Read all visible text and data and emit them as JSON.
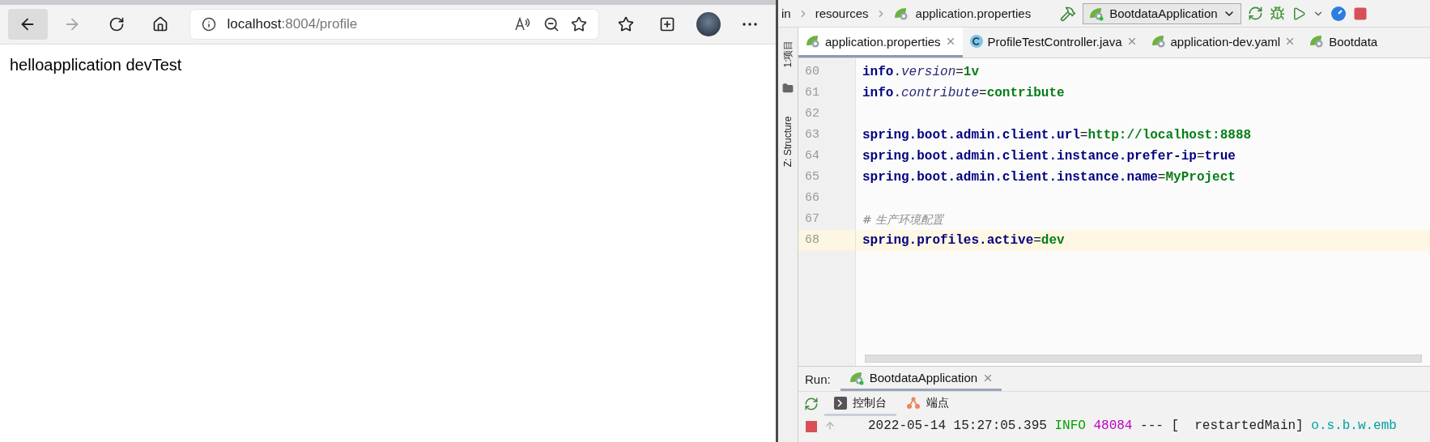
{
  "browser": {
    "nav_buttons": [
      {
        "kind": "back",
        "disabled": false,
        "hovered": true
      },
      {
        "kind": "forward",
        "disabled": true,
        "hovered": false
      },
      {
        "kind": "refresh",
        "disabled": false,
        "hovered": false
      },
      {
        "kind": "home",
        "disabled": false,
        "hovered": false
      }
    ],
    "address": {
      "host": "localhost",
      "path": ":8004/profile"
    },
    "page_text": "helloapplication devTest"
  },
  "ide": {
    "breadcrumbs": [
      "in",
      "resources",
      "application.properties"
    ],
    "run_config": "BootdataApplication",
    "tool_labels": [
      "1:项目",
      "Z: Structure"
    ],
    "tabs": [
      {
        "label": "application.properties",
        "kind": "spring",
        "selected": true,
        "closable": true
      },
      {
        "label": "ProfileTestController.java",
        "kind": "class",
        "selected": false,
        "closable": true
      },
      {
        "label": "application-dev.yaml",
        "kind": "spring",
        "selected": false,
        "closable": true
      },
      {
        "label": "Bootdata",
        "kind": "boot",
        "selected": false,
        "closable": false
      }
    ],
    "lines": [
      {
        "number": "60",
        "current": false,
        "tokens": [
          {
            "text": "info",
            "kind": "key"
          },
          {
            "text": ".",
            "kind": "op"
          },
          {
            "text": "version",
            "kind": "field"
          },
          {
            "text": "=",
            "kind": "op"
          },
          {
            "text": "1v",
            "kind": "value"
          }
        ]
      },
      {
        "number": "61",
        "current": false,
        "tokens": [
          {
            "text": "info",
            "kind": "key"
          },
          {
            "text": ".",
            "kind": "op"
          },
          {
            "text": "contribute",
            "kind": "field"
          },
          {
            "text": "=",
            "kind": "op"
          },
          {
            "text": "contribute",
            "kind": "value"
          }
        ]
      },
      {
        "number": "62",
        "current": false
      },
      {
        "number": "63",
        "current": false,
        "tokens": [
          {
            "text": "spring.boot.admin.client.url",
            "kind": "key"
          },
          {
            "text": "=",
            "kind": "op"
          },
          {
            "text": "http://localhost:8888",
            "kind": "value"
          }
        ]
      },
      {
        "number": "64",
        "current": false,
        "tokens": [
          {
            "text": "spring.boot.admin.client.instance.prefer-ip",
            "kind": "key"
          },
          {
            "text": "=",
            "kind": "op"
          },
          {
            "text": "true",
            "kind": "key"
          }
        ]
      },
      {
        "number": "65",
        "current": false,
        "tokens": [
          {
            "text": "spring.boot.admin.client.instance.name",
            "kind": "key"
          },
          {
            "text": "=",
            "kind": "op"
          },
          {
            "text": "MyProject",
            "kind": "value"
          }
        ]
      },
      {
        "number": "66",
        "current": false
      },
      {
        "number": "67",
        "current": false,
        "tokens": [
          {
            "text": "# 生产环境配置",
            "kind": "comment"
          }
        ]
      },
      {
        "number": "68",
        "current": true,
        "tokens": [
          {
            "text": "spring.profiles.active",
            "kind": "key"
          },
          {
            "text": "=",
            "kind": "op"
          },
          {
            "text": "dev",
            "kind": "value"
          }
        ]
      }
    ],
    "run_panel": {
      "label": "Run:",
      "tabs": [
        {
          "label": "BootdataApplication",
          "selected": true
        }
      ],
      "subtabs": [
        {
          "label": "控制台",
          "kind": "console",
          "selected": true
        },
        {
          "label": "端点",
          "kind": "endpoints",
          "selected": false
        }
      ],
      "log": [
        {
          "text": "2022-05-14 15:27:05.395",
          "kind": "plain"
        },
        {
          "text": "INFO",
          "kind": "level"
        },
        {
          "text": "48084",
          "kind": "pid"
        },
        {
          "text": "--- [  restartedMain]",
          "kind": "plain"
        },
        {
          "text": "o.s.b.w.emb",
          "kind": "logger"
        }
      ]
    }
  }
}
